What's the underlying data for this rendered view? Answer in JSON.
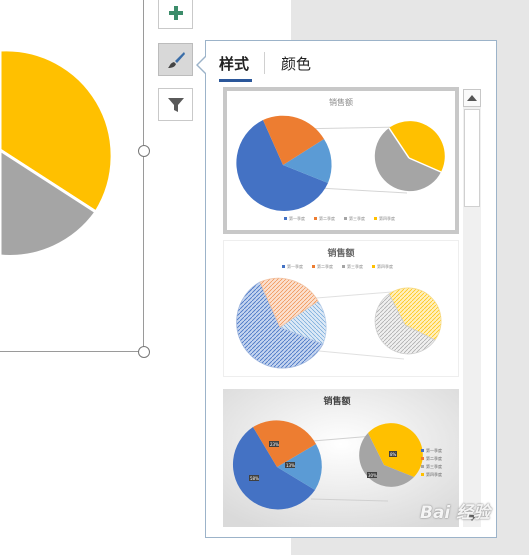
{
  "pane": {
    "tab_style": "样式",
    "tab_color": "颜色"
  },
  "thumbnails": [
    {
      "title": "销售额",
      "legend": [
        "第一季度",
        "第二季度",
        "第三季度",
        "第四季度"
      ]
    },
    {
      "title": "销售额",
      "legend": [
        "第一季度",
        "第二季度",
        "第三季度",
        "第四季度"
      ]
    },
    {
      "title": "销售额",
      "legend": [
        "第一季度",
        "第二季度",
        "第三季度",
        "第四季度"
      ],
      "labels": [
        "23%",
        "13%",
        "58%",
        "8%",
        "30%"
      ]
    }
  ],
  "watermark": "Bai 经验",
  "colors": {
    "blue": "#4472c4",
    "orange": "#ed7d31",
    "gray": "#a5a5a5",
    "gold": "#ffc000",
    "lightblue": "#5b9bd5",
    "accent": "#2b579a"
  },
  "icons": [
    "plus-icon",
    "brush-icon",
    "filter-icon",
    "chevron-up-icon",
    "chevron-down-icon"
  ]
}
